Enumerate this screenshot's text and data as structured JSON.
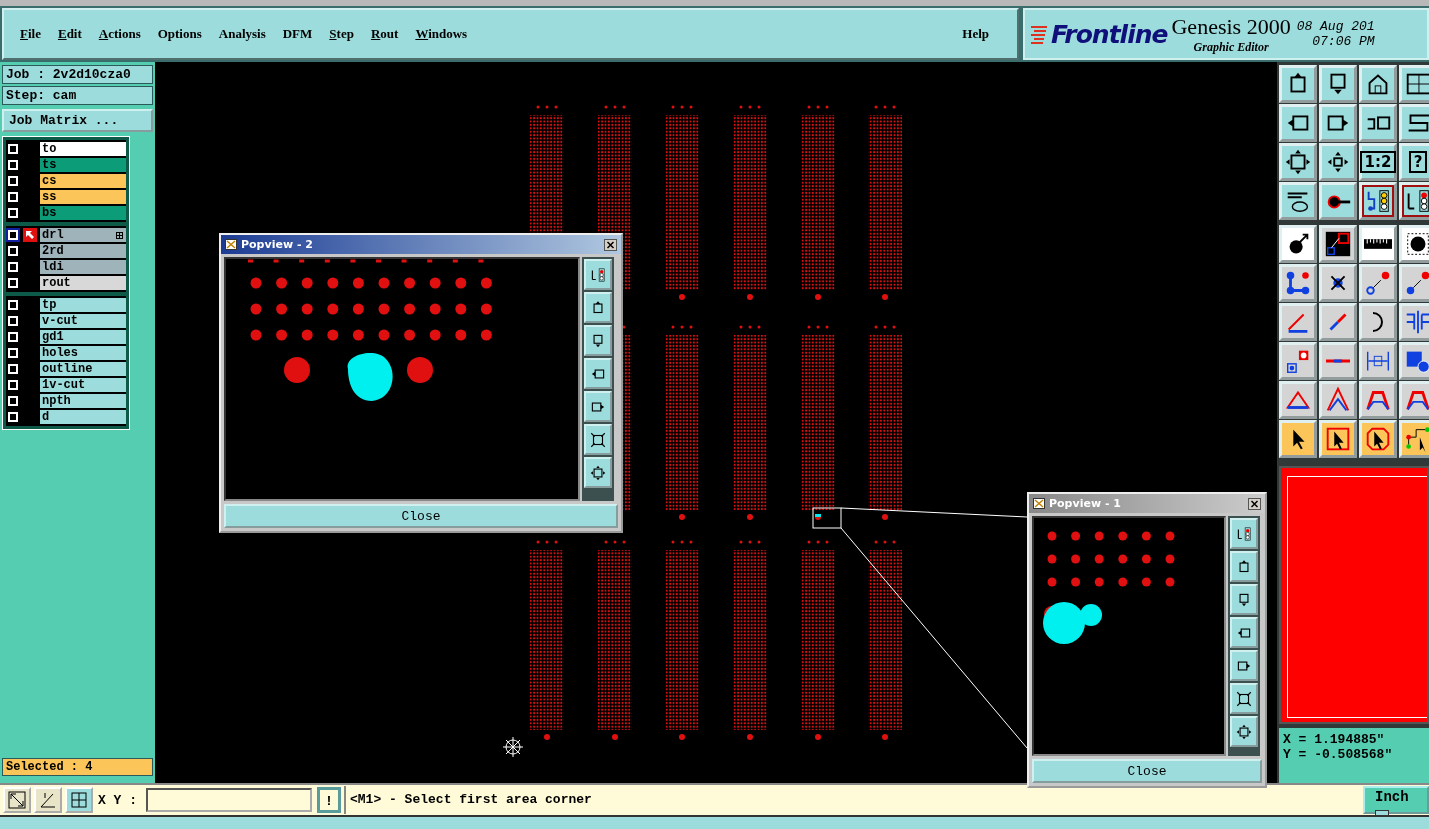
{
  "menu": {
    "items": [
      {
        "label": "File",
        "mnemonic": true
      },
      {
        "label": "Edit",
        "mnemonic": true
      },
      {
        "label": "Actions",
        "mnemonic": true
      },
      {
        "label": "Options",
        "mnemonic": false
      },
      {
        "label": "Analysis",
        "mnemonic": false
      },
      {
        "label": "DFM",
        "mnemonic": false
      },
      {
        "label": "Step",
        "mnemonic": true
      },
      {
        "label": "Rout",
        "mnemonic": true
      },
      {
        "label": "Windows",
        "mnemonic": true
      }
    ],
    "help": "Help"
  },
  "brand": {
    "logo": "Frontline",
    "product": "Genesis 2000",
    "subtitle": "Graphic Editor",
    "date": "08 Aug 201",
    "time": "07:06 PM"
  },
  "job": {
    "job_label": "Job : 2v2d10cza0",
    "step_label": "Step: cam",
    "matrix_button": "Job Matrix ..."
  },
  "layer_groups": [
    {
      "layers": [
        {
          "name": "to",
          "color": "#ffffff",
          "selected": false,
          "checked": false,
          "expand_icon": false
        },
        {
          "name": "ts",
          "color": "#0c9c78",
          "selected": false,
          "checked": false,
          "expand_icon": false
        },
        {
          "name": "cs",
          "color": "#fcc55a",
          "selected": false,
          "checked": false,
          "expand_icon": false
        },
        {
          "name": "ss",
          "color": "#fcc55a",
          "selected": false,
          "checked": false,
          "expand_icon": false
        },
        {
          "name": "bs",
          "color": "#0c9c78",
          "selected": false,
          "checked": false,
          "expand_icon": false
        }
      ]
    },
    {
      "layers": [
        {
          "name": "drl",
          "color": "#9fb3bb",
          "selected": true,
          "checked": false,
          "expand_icon": true
        },
        {
          "name": "2rd",
          "color": "#9fb3bb",
          "selected": false,
          "checked": false,
          "expand_icon": false
        },
        {
          "name": "ldi",
          "color": "#9fb3bb",
          "selected": false,
          "checked": false,
          "expand_icon": false
        },
        {
          "name": "rout",
          "color": "#d8d8d8",
          "selected": false,
          "checked": false,
          "expand_icon": false
        }
      ]
    },
    {
      "layers": [
        {
          "name": "tp",
          "color": "#9ddcdc",
          "selected": false,
          "checked": false,
          "expand_icon": false
        },
        {
          "name": "v-cut",
          "color": "#9ddcdc",
          "selected": false,
          "checked": false,
          "expand_icon": false
        },
        {
          "name": "gd1",
          "color": "#9ddcdc",
          "selected": false,
          "checked": false,
          "expand_icon": false
        },
        {
          "name": "holes",
          "color": "#9ddcdc",
          "selected": false,
          "checked": false,
          "expand_icon": false
        },
        {
          "name": "outline",
          "color": "#9ddcdc",
          "selected": false,
          "checked": false,
          "expand_icon": false
        },
        {
          "name": "1v-cut",
          "color": "#9ddcdc",
          "selected": false,
          "checked": false,
          "expand_icon": false
        },
        {
          "name": "npth",
          "color": "#9ddcdc",
          "selected": false,
          "checked": false,
          "expand_icon": false
        },
        {
          "name": "d",
          "color": "#9ddcdc",
          "selected": false,
          "checked": false,
          "expand_icon": false
        }
      ]
    }
  ],
  "selected_count": "Selected : 4",
  "toolbar": {
    "text_buttons": [
      "1:2",
      "?"
    ]
  },
  "popviews": [
    {
      "title": "Popview - 2",
      "close": "Close"
    },
    {
      "title": "Popview - 1",
      "close": "Close"
    }
  ],
  "coordinates": {
    "x": "X = 1.194885\"",
    "y": "Y = -0.508568\""
  },
  "command_line": {
    "label": "X Y :",
    "alert": "!",
    "message": "<M1> - Select first area corner",
    "units": "Inch"
  }
}
